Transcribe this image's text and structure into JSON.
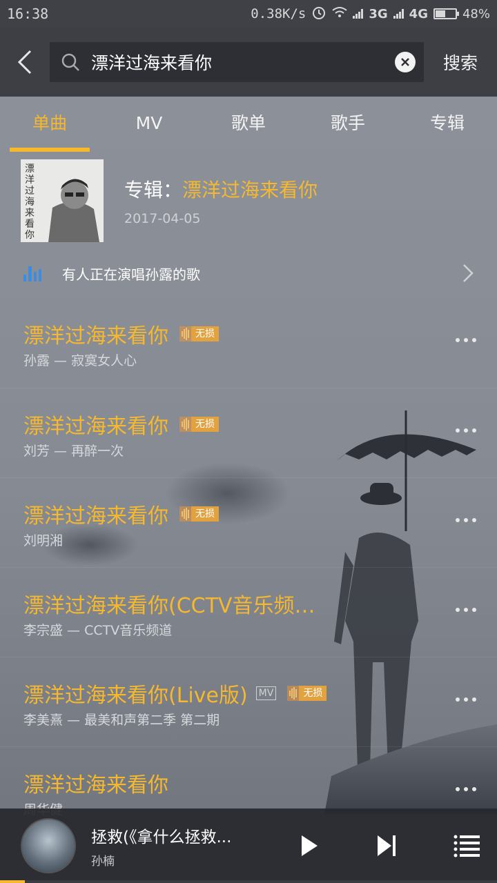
{
  "status_bar": {
    "time": "16:38",
    "net_speed": "0.38K/s",
    "net_3g": "3G",
    "net_4g": "4G",
    "battery": "48%",
    "battery_level": 0.48
  },
  "search": {
    "back_icon": "chevron-left-icon",
    "query": "漂洋过海来看你",
    "submit_label": "搜索"
  },
  "tabs": [
    {
      "label": "单曲",
      "active": true
    },
    {
      "label": "MV"
    },
    {
      "label": "歌单"
    },
    {
      "label": "歌手"
    },
    {
      "label": "专辑"
    }
  ],
  "album": {
    "prefix": "专辑：",
    "name": "漂洋过海来看你",
    "date": "2017-04-05",
    "cover_text": "漂洋过海来看你"
  },
  "banner": {
    "text": "有人正在演唱孙露的歌",
    "icon": "equalizer-bars-icon"
  },
  "songs": [
    {
      "title": "漂洋过海来看你",
      "subtitle": "孙露 — 寂寞女人心",
      "lossless": "无损"
    },
    {
      "title": "漂洋过海来看你",
      "subtitle": "刘芳 — 再醉一次",
      "lossless": "无损"
    },
    {
      "title": "漂洋过海来看你",
      "subtitle": "刘明湘",
      "lossless": "无损"
    },
    {
      "title": "漂洋过海来看你(CCTV音乐频…",
      "subtitle": "李宗盛 — CCTV音乐频道"
    },
    {
      "title": "漂洋过海来看你(Live版)",
      "subtitle": "李美熹 — 最美和声第二季 第二期",
      "mv": "MV",
      "lossless": "无损"
    },
    {
      "title": "漂洋过海来看你",
      "subtitle": "周华健"
    }
  ],
  "player": {
    "title": "拯救(《拿什么拯救...",
    "artist": "孙楠",
    "progress": 0.05
  },
  "colors": {
    "accent": "#f5b82e",
    "header_bg": "#3d3f45",
    "banner_icon": "#3b8de0"
  }
}
